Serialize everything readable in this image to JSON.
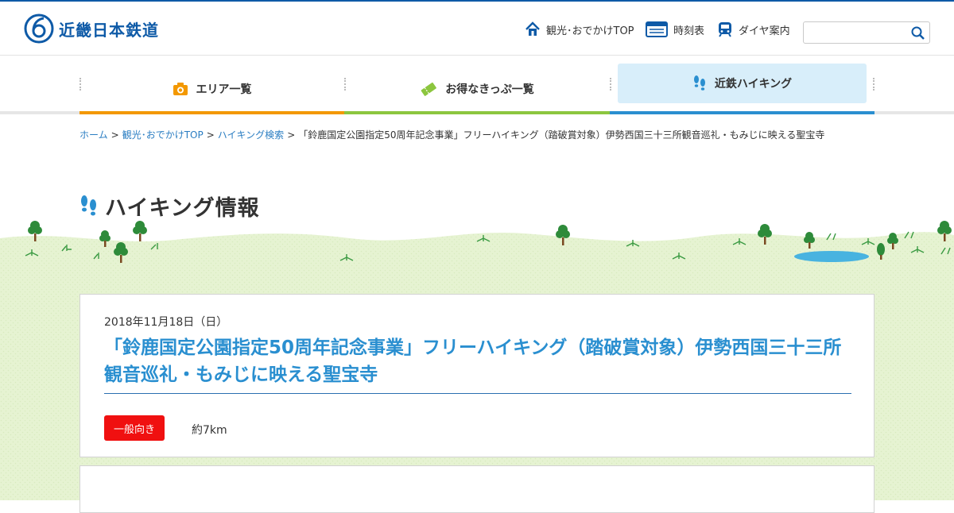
{
  "header": {
    "logo_text": "近畿日本鉄道",
    "util_links": [
      {
        "label": "観光･おでかけTOP",
        "icon": "house-icon"
      },
      {
        "label": "時刻表",
        "icon": "timetable-icon"
      },
      {
        "label": "ダイヤ案内",
        "icon": "train-icon"
      }
    ],
    "search": {
      "placeholder": "",
      "value": ""
    }
  },
  "nav": {
    "tabs": [
      {
        "label": "エリア一覧",
        "icon": "camera-icon",
        "color": "#f39800"
      },
      {
        "label": "お得なきっぷ一覧",
        "icon": "ticket-icon",
        "color": "#8cc63f"
      },
      {
        "label": "近鉄ハイキング",
        "icon": "footprints-icon",
        "color": "#2a8fd0",
        "active": true
      }
    ]
  },
  "breadcrumb": {
    "items": [
      "ホーム",
      "観光･おでかけTOP",
      "ハイキング検索"
    ],
    "current": "「鈴鹿国定公園指定50周年記念事業」フリーハイキング（踏破賞対象）伊勢西国三十三所観音巡礼・もみじに映える聖宝寺",
    "separator": ">"
  },
  "page": {
    "heading": "ハイキング情報"
  },
  "event": {
    "date": "2018年11月18日（日）",
    "title": "「鈴鹿国定公園指定50周年記念事業」フリーハイキング（踏破賞対象）伊勢西国三十三所観音巡礼・もみじに映える聖宝寺",
    "level": "一般向き",
    "distance": "約7km"
  },
  "colors": {
    "brand": "#0e5aa7",
    "link": "#2a7dc2",
    "title": "#2a8fd0",
    "badge": "#f01010",
    "grass": "#e6f3d2"
  }
}
